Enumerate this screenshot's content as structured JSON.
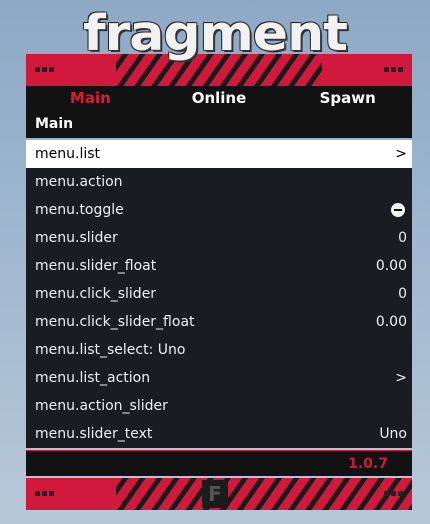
{
  "logo": {
    "text": "fragment"
  },
  "tabs": [
    {
      "label": "Main",
      "active": true
    },
    {
      "label": "Online",
      "active": false
    },
    {
      "label": "Spawn",
      "active": false
    }
  ],
  "section_title": "Main",
  "items": [
    {
      "label": "menu.list",
      "value": ">"
    },
    {
      "label": "menu.action",
      "value": ""
    },
    {
      "label": "menu.toggle",
      "value": "",
      "icon": "toggle-off-icon"
    },
    {
      "label": "menu.slider",
      "value": "0"
    },
    {
      "label": "menu.slider_float",
      "value": "0.00"
    },
    {
      "label": "menu.click_slider",
      "value": "0"
    },
    {
      "label": "menu.click_slider_float",
      "value": "0.00"
    },
    {
      "label": "menu.list_select: Uno",
      "value": ""
    },
    {
      "label": "menu.list_action",
      "value": ">"
    },
    {
      "label": "menu.action_slider",
      "value": ""
    },
    {
      "label": "menu.slider_text",
      "value": "Uno"
    }
  ],
  "version": "1.0.7",
  "footer_logo": "F",
  "colors": {
    "accent": "#d0193c",
    "panel": "#121212",
    "list_bg": "#1b1c21",
    "selected_bg": "#ffffff"
  }
}
